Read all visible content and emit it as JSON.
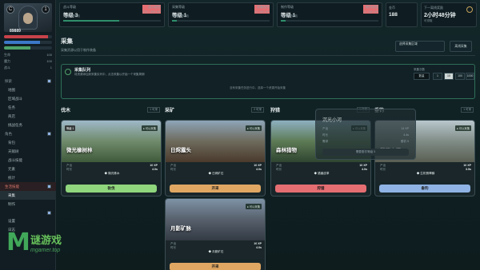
{
  "player": {
    "level_badge_left": "C",
    "level_badge_right": "1",
    "name": "89889",
    "tag": "阿米诺",
    "hp": 0.92,
    "mp": 0.75,
    "xp": 0.55,
    "stats": [
      {
        "k": "生命",
        "v": "100"
      },
      {
        "k": "魔力",
        "v": "100"
      },
      {
        "k": "战斗",
        "v": "1"
      }
    ]
  },
  "nav": {
    "sections": [
      {
        "title": "探索",
        "items": [
          "地图",
          "区域战斗",
          "任务",
          "商店",
          "挑战任务"
        ]
      },
      {
        "title": "角色",
        "items": [
          "背包",
          "天赋树",
          "战斗技能",
          "元素",
          "统计"
        ]
      },
      {
        "title": "生活技能",
        "items": [
          "采集",
          "制作"
        ]
      },
      {
        "title": "",
        "items": [
          "设置",
          "日志"
        ]
      }
    ],
    "active_section": "生活技能",
    "current_item": "采集"
  },
  "top": {
    "cards": [
      {
        "title": "战斗等级",
        "level": "等级 3",
        "right_top": "战斗经验",
        "right_val": "171 / 300 XP",
        "sub": "升级所需经验",
        "progress": 0.57
      },
      {
        "title": "采集等级",
        "level": "等级 1",
        "right_top": "采集经验",
        "right_val": "0 / 100 XP",
        "sub": "采集所需经验",
        "progress": 0.05
      },
      {
        "title": "制作等级",
        "level": "等级 1",
        "right_top": "制作经验",
        "right_val": "0 / 100 XP",
        "sub": "制作所需经验",
        "progress": 0.05
      }
    ],
    "coins_label": "金币",
    "coins_value": "188",
    "timer_label": "下一离线奖励",
    "timer_value": "2小时48分钟",
    "timer_sub": "可领取"
  },
  "header": {
    "title": "采集",
    "subtitle": "采集资源以用于制作装备",
    "select_label": "选择采集区域",
    "button_label": "离线采集"
  },
  "queue": {
    "title": "采集队列",
    "subtitle": "将资源添加到采集队列中，点击采集以开始一个采集周期",
    "empty": "没有采集任务进行中。选择一个资源开始采集",
    "count_label": "采集次数",
    "count_value": "数量",
    "options": [
      "1",
      "10",
      "100",
      "1000"
    ]
  },
  "columns": [
    {
      "title": "伐木",
      "count": "1 可采"
    },
    {
      "title": "采矿",
      "count": "2 可采"
    },
    {
      "title": "狩猎",
      "count": "1 可采"
    },
    {
      "title": "垂钓",
      "count": "1 可采"
    }
  ],
  "cards": [
    {
      "name": "微光橡树林",
      "tag": "● 可以采集",
      "level": "等级 1",
      "rows": [
        [
          "产出",
          "10 XP"
        ],
        [
          "时长",
          "4.0s"
        ]
      ],
      "loot": "◆ 微光橡木",
      "action": "砍伐",
      "color": "#8fd67d"
    },
    {
      "name": "日烬露头",
      "tag": "● 可以采集",
      "level": "",
      "rows": [
        [
          "产出",
          "10 XP"
        ],
        [
          "时长",
          "4.0s"
        ]
      ],
      "loot": "◆ 日烬矿石",
      "action": "开采",
      "color": "#e0a763"
    },
    {
      "name": "森林猎物",
      "tag": "● 可以采集",
      "level": "",
      "rows": [
        [
          "产出",
          "10 XP"
        ],
        [
          "时长",
          "4.0s"
        ]
      ],
      "loot": "◆ 猎兽皮革",
      "action": "狩猎",
      "color": "#e46e72"
    },
    {
      "name": "翡翠水潭",
      "tag": "● 可以采集",
      "level": "",
      "rows": [
        [
          "产出",
          "10 XP"
        ],
        [
          "时长",
          "3.5s"
        ]
      ],
      "loot": "◆ 生机翡翠鳞",
      "action": "垂钓",
      "color": "#8fb3e4"
    },
    {
      "name": "月影矿脉",
      "tag": "● 可以采集",
      "level": "",
      "rows": [
        [
          "产出",
          "10 XP"
        ],
        [
          "时长",
          "4.0s"
        ]
      ],
      "loot": "◆ 月影矿石",
      "action": "开采",
      "color": "#e0a763"
    }
  ],
  "locked": {
    "name": "沉光小河",
    "rows": [
      [
        "产出",
        "14 XP"
      ],
      [
        "时长",
        "4.4s"
      ],
      [
        "需求",
        "垂钓 5"
      ]
    ],
    "lock_label": "需要垂钓等级 5"
  },
  "watermark": {
    "mark": "M",
    "cn": "谜游戏",
    "en": "mgamer.top"
  }
}
